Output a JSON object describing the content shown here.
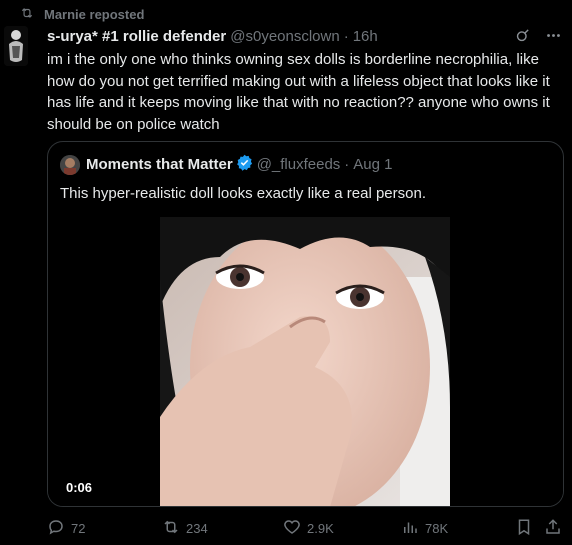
{
  "repost": {
    "label": "Marnie reposted",
    "icon": "repost-icon"
  },
  "tweet": {
    "display_name": "s-urya* #1 rollie defender",
    "handle": "@s0yeonsclown",
    "separator": "·",
    "time": "16h",
    "text": "im i the only one who thinks owning sex dolls is borderline necrophilia, like how do you not get terrified making out with a lifeless object that looks like it has life and it keeps moving like that with no reaction?? anyone who owns it should be on police watch"
  },
  "quote": {
    "display_name": "Moments that Matter",
    "handle": "@_fluxfeeds",
    "separator": "·",
    "date": "Aug 1",
    "text": "This hyper-realistic doll looks exactly like a real person.",
    "video_time": "0:06"
  },
  "actions": {
    "replies": "72",
    "reposts": "234",
    "likes": "2.9K",
    "views": "78K"
  },
  "colors": {
    "background": "#000000",
    "text": "#e7e9ea",
    "muted": "#71767b",
    "border": "#2f3336",
    "verified": "#1d9bf0"
  }
}
